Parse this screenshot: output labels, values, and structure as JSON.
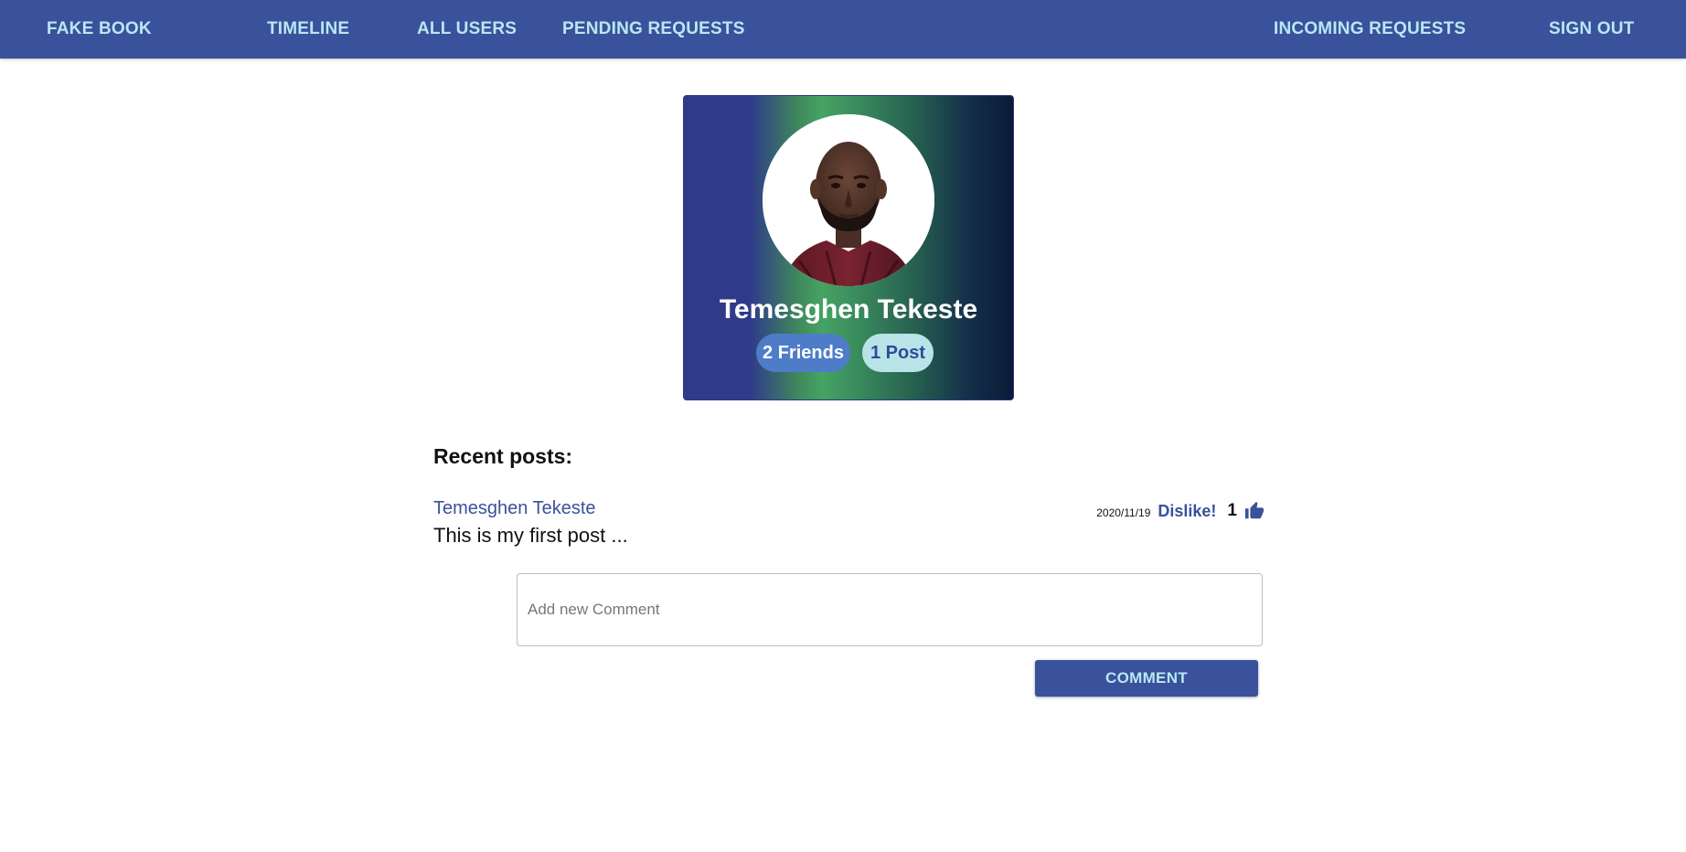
{
  "nav": {
    "brand": "FAKE BOOK",
    "timeline": "TIMELINE",
    "all_users": "ALL USERS",
    "pending_requests": "PENDING REQUESTS",
    "incoming_requests": "INCOMING REQUESTS",
    "sign_out": "SIGN OUT"
  },
  "profile": {
    "name": "Temesghen Tekeste",
    "friends_badge": "2 Friends",
    "posts_badge": "1 Post",
    "avatar_icon": "user-photo"
  },
  "recent_posts": {
    "title": "Recent posts:",
    "posts": [
      {
        "author": "Temesghen Tekeste",
        "date": "2020/11/19",
        "dislike_label": "Dislike!",
        "likes": "1",
        "like_icon": "thumbs-up-icon",
        "body": "This is my first post ..."
      }
    ]
  },
  "comment_form": {
    "placeholder": "Add new Comment",
    "button_label": "COMMENT"
  },
  "colors": {
    "navbar": "#3a519b",
    "nav_text": "#b8e8f2",
    "friends_badge": "#4f7cc9",
    "posts_badge": "#b8e4e8"
  }
}
